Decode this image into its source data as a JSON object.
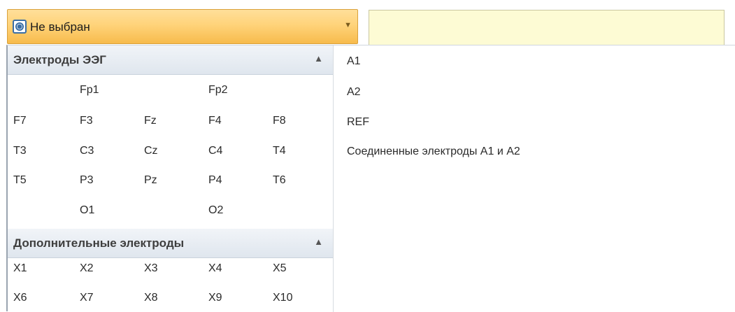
{
  "combo": {
    "label": "Не выбран"
  },
  "groups": [
    {
      "title": "Электроды ЭЭГ",
      "rows": [
        [
          "",
          "Fp1",
          "",
          "Fp2",
          ""
        ],
        [
          "F7",
          "F3",
          "Fz",
          "F4",
          "F8"
        ],
        [
          "T3",
          "C3",
          "Cz",
          "C4",
          "T4"
        ],
        [
          "T5",
          "P3",
          "Pz",
          "P4",
          "T6"
        ],
        [
          "",
          "O1",
          "",
          "O2",
          ""
        ]
      ]
    },
    {
      "title": "Дополнительные электроды",
      "rows": [
        [
          "X1",
          "X2",
          "X3",
          "X4",
          "X5"
        ],
        [
          "X6",
          "X7",
          "X8",
          "X9",
          "X10"
        ]
      ]
    }
  ],
  "right_items": [
    "A1",
    "A2",
    "REF",
    "Соединенные электроды A1 и A2"
  ]
}
